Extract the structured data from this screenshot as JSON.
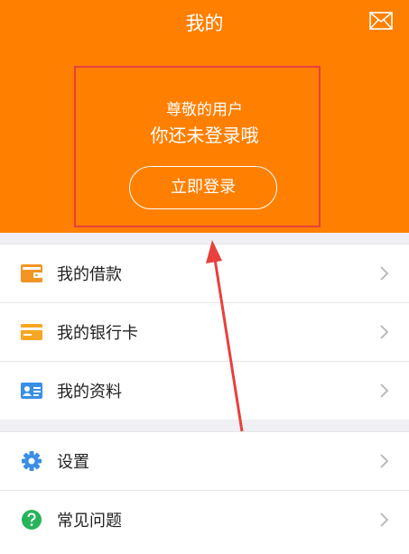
{
  "header": {
    "title": "我的",
    "greeting": "尊敬的用户",
    "status": "你还未登录哦",
    "login_button": "立即登录",
    "mail_icon": "mail-icon"
  },
  "menu_group_1": [
    {
      "label": "我的借款",
      "icon": "wallet-icon"
    },
    {
      "label": "我的银行卡",
      "icon": "bank-card-icon"
    },
    {
      "label": "我的资料",
      "icon": "id-card-icon"
    }
  ],
  "menu_group_2": [
    {
      "label": "设置",
      "icon": "gear-icon"
    },
    {
      "label": "常见问题",
      "icon": "question-icon"
    }
  ],
  "colors": {
    "accent": "#ff7f00",
    "annotation": "#e8403c",
    "settings_blue": "#3a8ee6",
    "faq_green": "#27b35a"
  }
}
